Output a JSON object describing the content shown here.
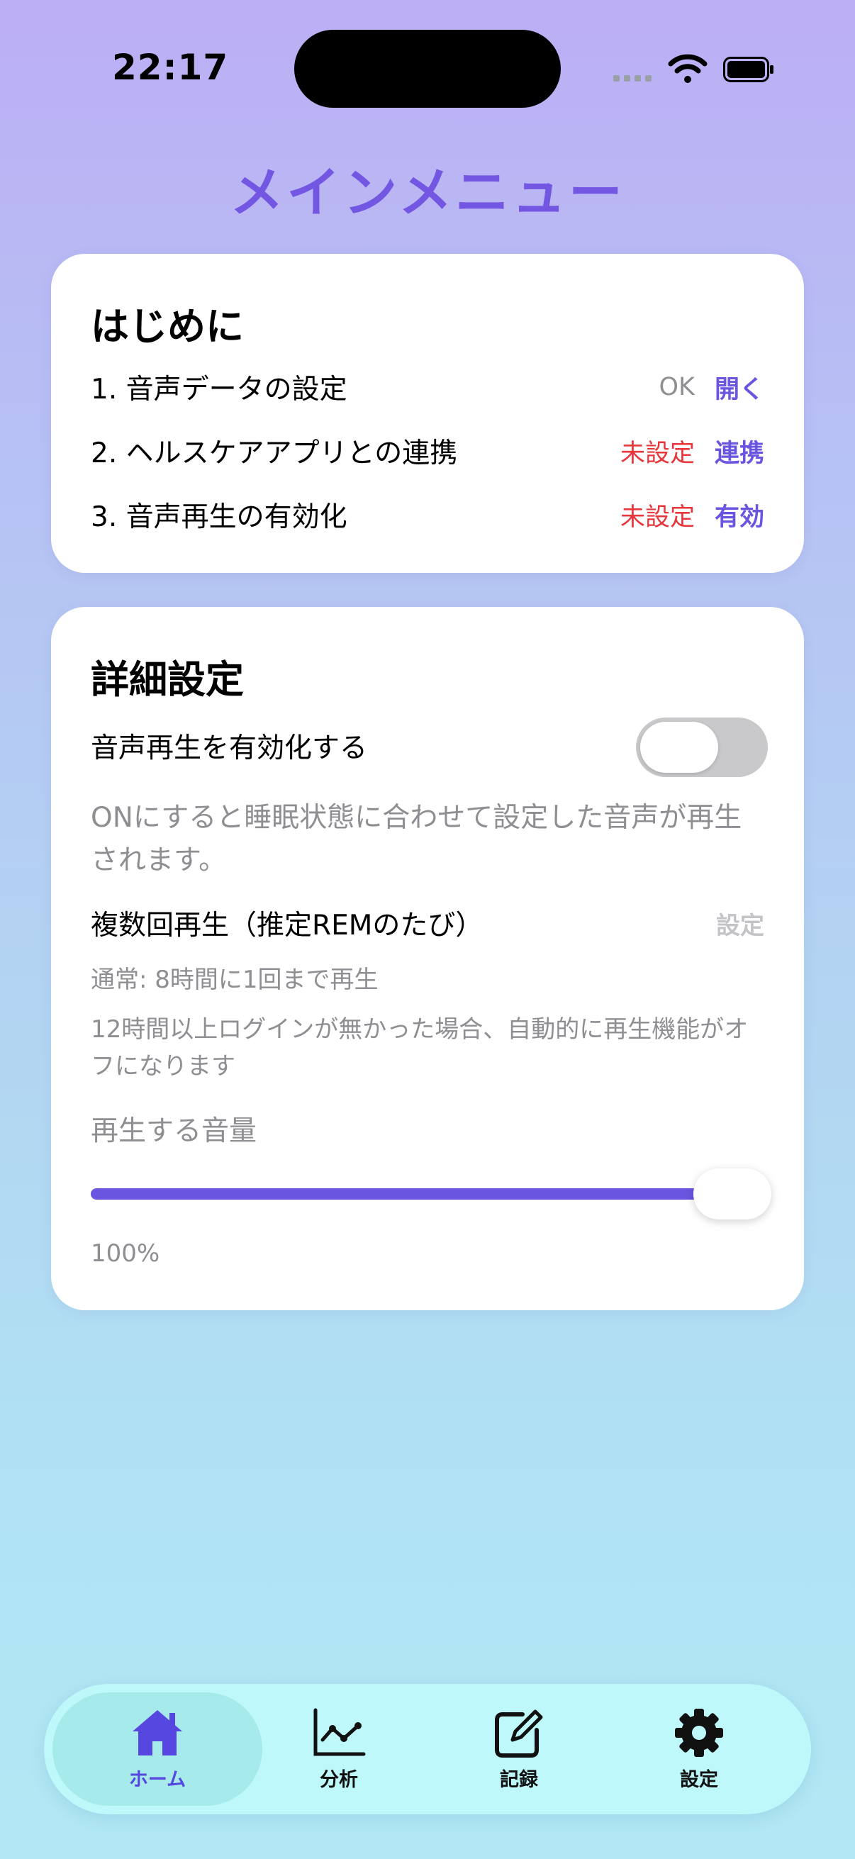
{
  "status_bar": {
    "time": "22:17"
  },
  "title": "メインメニュー",
  "intro_card": {
    "heading": "はじめに",
    "steps": [
      {
        "label": "1. 音声データの設定",
        "status": "OK",
        "status_state": "ok",
        "action": "開く"
      },
      {
        "label": "2. ヘルスケアアプリとの連携",
        "status": "未設定",
        "status_state": "unset",
        "action": "連携"
      },
      {
        "label": "3. 音声再生の有効化",
        "status": "未設定",
        "status_state": "unset",
        "action": "有効"
      }
    ]
  },
  "detail_card": {
    "heading": "詳細設定",
    "toggle_label": "音声再生を有効化する",
    "toggle_on": false,
    "description": "ONにすると睡眠状態に合わせて設定した音声が再生されます。",
    "multi_play_label": "複数回再生（推定REMのたび）",
    "multi_play_action": "設定",
    "note_normal": "通常: 8時間に1回まで再生",
    "note_auto_off": "12時間以上ログインが無かった場合、自動的に再生機能がオフになります",
    "volume_label": "再生する音量",
    "volume_fraction": 1.0,
    "volume_value": "100%"
  },
  "tabbar": {
    "tabs": [
      {
        "label": "ホーム",
        "icon": "house-icon",
        "active": true
      },
      {
        "label": "分析",
        "icon": "chart-line-icon",
        "active": false
      },
      {
        "label": "記録",
        "icon": "edit-note-icon",
        "active": false
      },
      {
        "label": "設定",
        "icon": "gear-icon",
        "active": false
      }
    ]
  },
  "colors": {
    "accent": "#6a55e0",
    "title": "#7357e3",
    "status_ok": "#8e8e93",
    "status_unset": "#e8373c",
    "tab_active_label": "#5547e0"
  }
}
